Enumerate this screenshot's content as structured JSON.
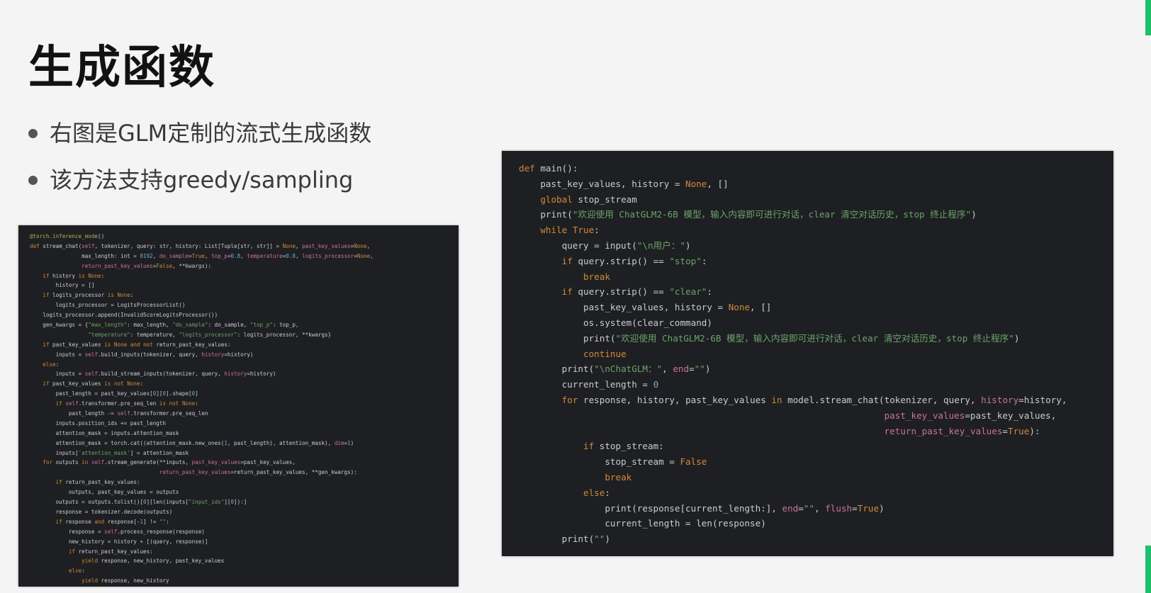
{
  "slide": {
    "title": "生成函数",
    "bullets": [
      "右图是GLM定制的流式生成函数",
      "该方法支持greedy/sampling"
    ]
  },
  "colors": {
    "background": "#f4f4f4",
    "code_bg": "#1e1f22",
    "keyword": "#d08a3a",
    "string": "#6aa46a",
    "param": "#c9729f",
    "accent_edge": "#1fbf6c"
  },
  "left_code": {
    "lines": [
      "@torch.inference_mode()",
      "def stream_chat(self, tokenizer, query: str, history: List[Tuple[str, str]] = None, past_key_values=None,",
      "                max_length: int = 8192, do_sample=True, top_p=0.8, temperature=0.8, logits_processor=None,",
      "                return_past_key_values=False, **kwargs):",
      "    if history is None:",
      "        history = []",
      "    if logits_processor is None:",
      "        logits_processor = LogitsProcessorList()",
      "    logits_processor.append(InvalidScoreLogitsProcessor())",
      "    gen_kwargs = {\"max_length\": max_length, \"do_sample\": do_sample, \"top_p\": top_p,",
      "                  \"temperature\": temperature, \"logits_processor\": logits_processor, **kwargs}",
      "    if past_key_values is None and not return_past_key_values:",
      "        inputs = self.build_inputs(tokenizer, query, history=history)",
      "    else:",
      "        inputs = self.build_stream_inputs(tokenizer, query, history=history)",
      "    if past_key_values is not None:",
      "        past_length = past_key_values[0][0].shape[0]",
      "        if self.transformer.pre_seq_len is not None:",
      "            past_length -= self.transformer.pre_seq_len",
      "        inputs.position_ids += past_length",
      "        attention_mask = inputs.attention_mask",
      "        attention_mask = torch.cat((attention_mask.new_ones(1, past_length), attention_mask), dim=1)",
      "        inputs['attention_mask'] = attention_mask",
      "    for outputs in self.stream_generate(**inputs, past_key_values=past_key_values,",
      "                                        return_past_key_values=return_past_key_values, **gen_kwargs):",
      "        if return_past_key_values:",
      "            outputs, past_key_values = outputs",
      "        outputs = outputs.tolist()[0][len(inputs[\"input_ids\"][0]):]",
      "        response = tokenizer.decode(outputs)",
      "        if response and response[-1] != \"\u0000\":",
      "            response = self.process_response(response)",
      "            new_history = history + [(query, response)]",
      "            if return_past_key_values:",
      "                yield response, new_history, past_key_values",
      "            else:",
      "                yield response, new_history"
    ]
  },
  "right_code": {
    "lines": [
      "def main():",
      "    past_key_values, history = None, []",
      "    global stop_stream",
      "    print(\"欢迎使用 ChatGLM2-6B 模型，输入内容即可进行对话，clear 清空对话历史，stop 终止程序\")",
      "    while True:",
      "        query = input(\"\\n用户：\")",
      "        if query.strip() == \"stop\":",
      "            break",
      "        if query.strip() == \"clear\":",
      "            past_key_values, history = None, []",
      "            os.system(clear_command)",
      "            print(\"欢迎使用 ChatGLM2-6B 模型，输入内容即可进行对话，clear 清空对话历史，stop 终止程序\")",
      "            continue",
      "        print(\"\\nChatGLM：\", end=\"\")",
      "        current_length = 0",
      "        for response, history, past_key_values in model.stream_chat(tokenizer, query, history=history,",
      "                                                                    past_key_values=past_key_values,",
      "                                                                    return_past_key_values=True):",
      "            if stop_stream:",
      "                stop_stream = False",
      "                break",
      "            else:",
      "                print(response[current_length:], end=\"\", flush=True)",
      "                current_length = len(response)",
      "        print(\"\")"
    ]
  }
}
